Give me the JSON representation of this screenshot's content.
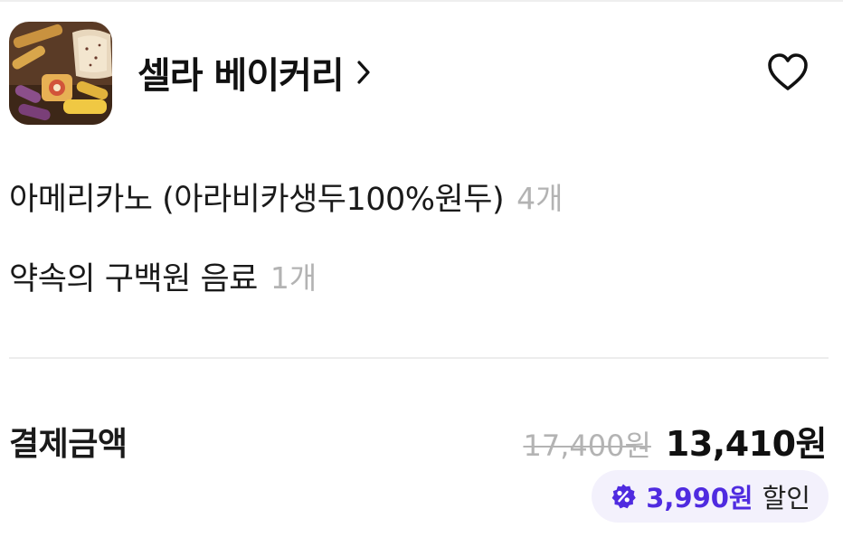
{
  "store": {
    "name": "셀라 베이커리",
    "thumbnail_icon": "bakery-photo"
  },
  "favorite": {
    "icon": "heart-outline-icon"
  },
  "order_items": [
    {
      "name": "아메리카노 (아라비카생두100%원두)",
      "quantity": "4개"
    },
    {
      "name": "약속의 구백원 음료",
      "quantity": "1개"
    }
  ],
  "payment": {
    "label": "결제금액",
    "original_price": "17,400원",
    "final_price": "13,410원",
    "discount": {
      "amount": "3,990원",
      "suffix": "할인",
      "icon": "percent-badge-icon"
    }
  },
  "colors": {
    "discount_accent": "#4f2be0",
    "discount_badge_bg": "#f3f1fc",
    "muted_text": "#b3b3b3"
  }
}
